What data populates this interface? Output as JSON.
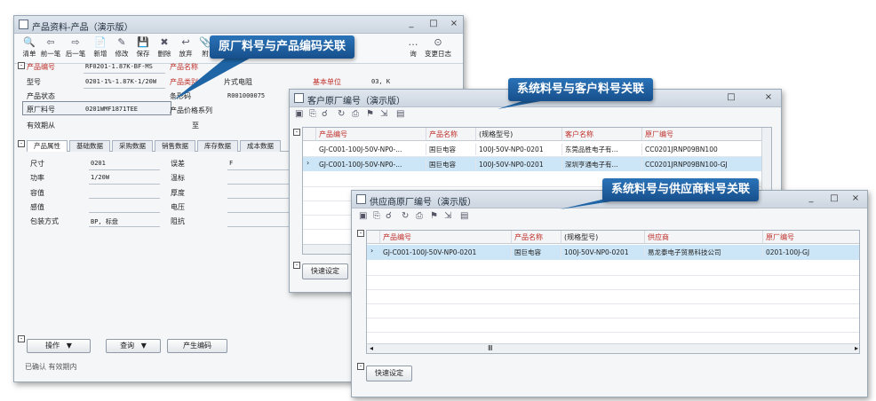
{
  "win1": {
    "title": "产品资料-产品（演示版）",
    "controls": [
      "_",
      "□",
      "×"
    ],
    "toolbar": [
      {
        "icon": "list-icon",
        "glyph": "🔍",
        "label": "清单"
      },
      {
        "icon": "prev-icon",
        "glyph": "⇦",
        "label": "前一笔"
      },
      {
        "icon": "next-icon",
        "glyph": "⇨",
        "label": "后一笔"
      },
      {
        "icon": "new-icon",
        "glyph": "📄",
        "label": "新增"
      },
      {
        "icon": "edit-icon",
        "glyph": "✎",
        "label": "修改"
      },
      {
        "icon": "save-icon",
        "glyph": "💾",
        "label": "保存"
      },
      {
        "icon": "delete-icon",
        "glyph": "✖",
        "label": "删除"
      },
      {
        "icon": "discard-icon",
        "glyph": "↩",
        "label": "放弃"
      },
      {
        "icon": "attach-icon",
        "glyph": "📎",
        "label": "附"
      }
    ],
    "toolbar_right": [
      {
        "icon": "log-icon",
        "glyph": "⊙",
        "label": "变更日志"
      },
      {
        "icon": "more-icon",
        "glyph": "…",
        "label": "询"
      }
    ],
    "fields": {
      "product_code_label": "产品编号",
      "product_code": "RF0201-1.87K-BF-MS",
      "product_name_label": "产品名称",
      "model_label": "型号",
      "model": "0201-1%-1.87K-1/20W",
      "category_label": "产品类别",
      "category_value": "片式电阻",
      "unit_label": "基本单位",
      "unit_value": "03, K",
      "status_label": "产品状态",
      "barcode_label": "条形码",
      "barcode_value": "R001000075",
      "orig_code_label": "原厂料号",
      "orig_code": "0201WMF1871TEE",
      "price_label": "产品价格系列",
      "valid_label": "有效期从",
      "valid_to": "至"
    },
    "tabs": [
      "产品属性",
      "基础数据",
      "采购数据",
      "销售数据",
      "库存数据",
      "成本数据"
    ],
    "attributes": {
      "size_label": "尺寸",
      "size": "0201",
      "power_label": "功率",
      "power": "1/20W",
      "capacitance_label": "容值",
      "inductance_label": "感值",
      "package_label": "包装方式",
      "package": "BP, 标盘",
      "tolerance_label": "误差",
      "tolerance": "F",
      "temp_label": "温标",
      "thickness_label": "厚度",
      "voltage_label": "电压",
      "resistance_label": "阻抗"
    },
    "buttons": {
      "operate": "操作",
      "query": "查询",
      "generate": "产生编码"
    },
    "status": "已确认  有效期内"
  },
  "win2": {
    "title": "客户原厂编号（演示版）",
    "columns": [
      "产品编号",
      "产品名称",
      "(规格型号)",
      "客户名称",
      "原厂编号"
    ],
    "rows": [
      [
        "GJ-C001-100J-50V-NP0-...",
        "国巨电容",
        "100J-50V-NP0-0201",
        "东莞品胜电子有...",
        "CC0201JRNP09BN100"
      ],
      [
        "GJ-C001-100J-50V-NP0-...",
        "国巨电容",
        "100J-50V-NP0-0201",
        "深圳亨通电子有...",
        "CC0201JRNP09BN100-GJ"
      ]
    ],
    "quick_button": "快速设定"
  },
  "win3": {
    "title": "供应商原厂编号（演示版）",
    "columns": [
      "产品编号",
      "产品名称",
      "(规格型号)",
      "供应商",
      "原厂编号"
    ],
    "rows": [
      [
        "GJ-C001-100J-50V-NP0-0201",
        "国巨电容",
        "100J-50V-NP0-0201",
        "易龙泰电子贸易科技公司",
        "0201-100J-GJ"
      ]
    ],
    "quick_button": "快速设定"
  },
  "callouts": {
    "c1": "原厂料号与产品编码关联",
    "c2": "系统料号与客户料号关联",
    "c3": "系统料号与供应商料号关联"
  },
  "colors": {
    "callout": "#1f65a6",
    "selected_row": "#cde6f7",
    "required_label": "#c0302a"
  }
}
